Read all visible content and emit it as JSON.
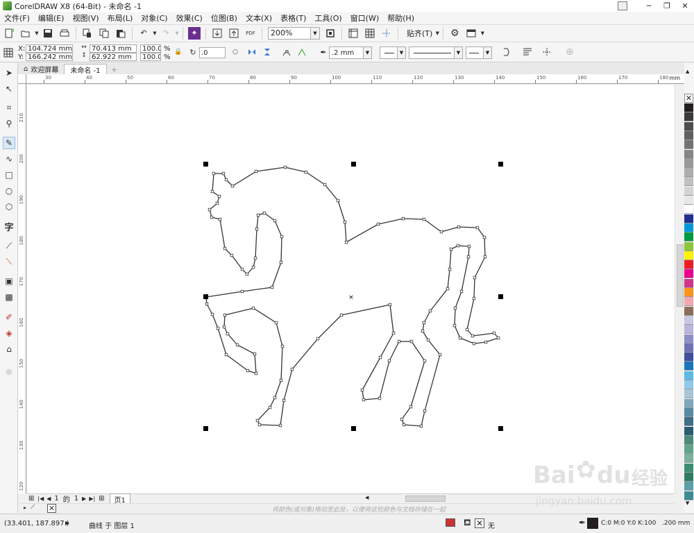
{
  "window": {
    "title": "CorelDRAW X8 (64-Bit) - 未命名 -1",
    "minimize": "─",
    "restore": "❐",
    "close": "✕"
  },
  "menu": [
    "文件(F)",
    "编辑(E)",
    "视图(V)",
    "布局(L)",
    "对象(C)",
    "效果(C)",
    "位图(B)",
    "文本(X)",
    "表格(T)",
    "工具(O)",
    "窗口(W)",
    "帮助(H)"
  ],
  "toolbar": {
    "zoom": "200%",
    "snap_label": "贴齐(T)",
    "pdf_label": "PDF"
  },
  "properties": {
    "x": "104.724 mm",
    "y": "166.242 mm",
    "x_label": "X:",
    "y_label": "Y:",
    "width": "70.413 mm",
    "height": "62.922 mm",
    "scale_w": "100.0",
    "scale_h": "100.0",
    "percent": "%",
    "rotation": ".0",
    "outline_width": ".2 mm"
  },
  "tabs": {
    "welcome": "欢迎屏幕",
    "document": "未命名 -1",
    "add": "+"
  },
  "ruler": {
    "unit": "mm",
    "top_ticks": [
      "30",
      "40",
      "50",
      "60",
      "70",
      "80",
      "90",
      "100",
      "110",
      "120",
      "130",
      "140",
      "150",
      "160",
      "170",
      "180"
    ],
    "left_ticks": [
      "210",
      "200",
      "190",
      "180",
      "170",
      "160",
      "150",
      "140",
      "130",
      "120"
    ]
  },
  "pager": {
    "current": "1",
    "of": "的",
    "total": "1",
    "page_tab": "页1"
  },
  "hint": "将颜色(或对象)拖动至此处，以便将这些颜色与文档存储在一起",
  "status": {
    "coords": "(33.401, 187.897 )",
    "object": "曲线 于 图层 1",
    "fill_none": "无",
    "cmyk": "C:0 M:0 Y:0 K:100",
    "outline": ".200 mm"
  },
  "palette_colors": [
    "#231f20",
    "#3a3a3a",
    "#4d4d4d",
    "#606060",
    "#737373",
    "#868686",
    "#999999",
    "#adadad",
    "#c0c0c0",
    "#d4d4d4",
    "#e8e8e8",
    "#ffffff",
    "#1f2f8f",
    "#0099d8",
    "#009a44",
    "#8cc63f",
    "#fff200",
    "#ed1c24",
    "#ec008c",
    "#d1338a",
    "#f7941d",
    "#f4a6b4",
    "#8b6d5c",
    "#c8c8e0",
    "#b8b6dc",
    "#8d8fc7",
    "#6f71b5",
    "#3f4fa0",
    "#1b75bc",
    "#5bb9e6",
    "#8fc9ea",
    "#a9c6d8",
    "#7fa7bb",
    "#5a8aa0",
    "#3f6f86",
    "#2d5c70",
    "#4e8a7a",
    "#5fa38a",
    "#7ab39a",
    "#3a8f72",
    "#2e7d62",
    "#5aa0a8",
    "#3d8b95"
  ],
  "watermark": {
    "text1": "Bai",
    "text2": "du",
    "text3": "经验",
    "url": "jingyan.baidu.com"
  }
}
